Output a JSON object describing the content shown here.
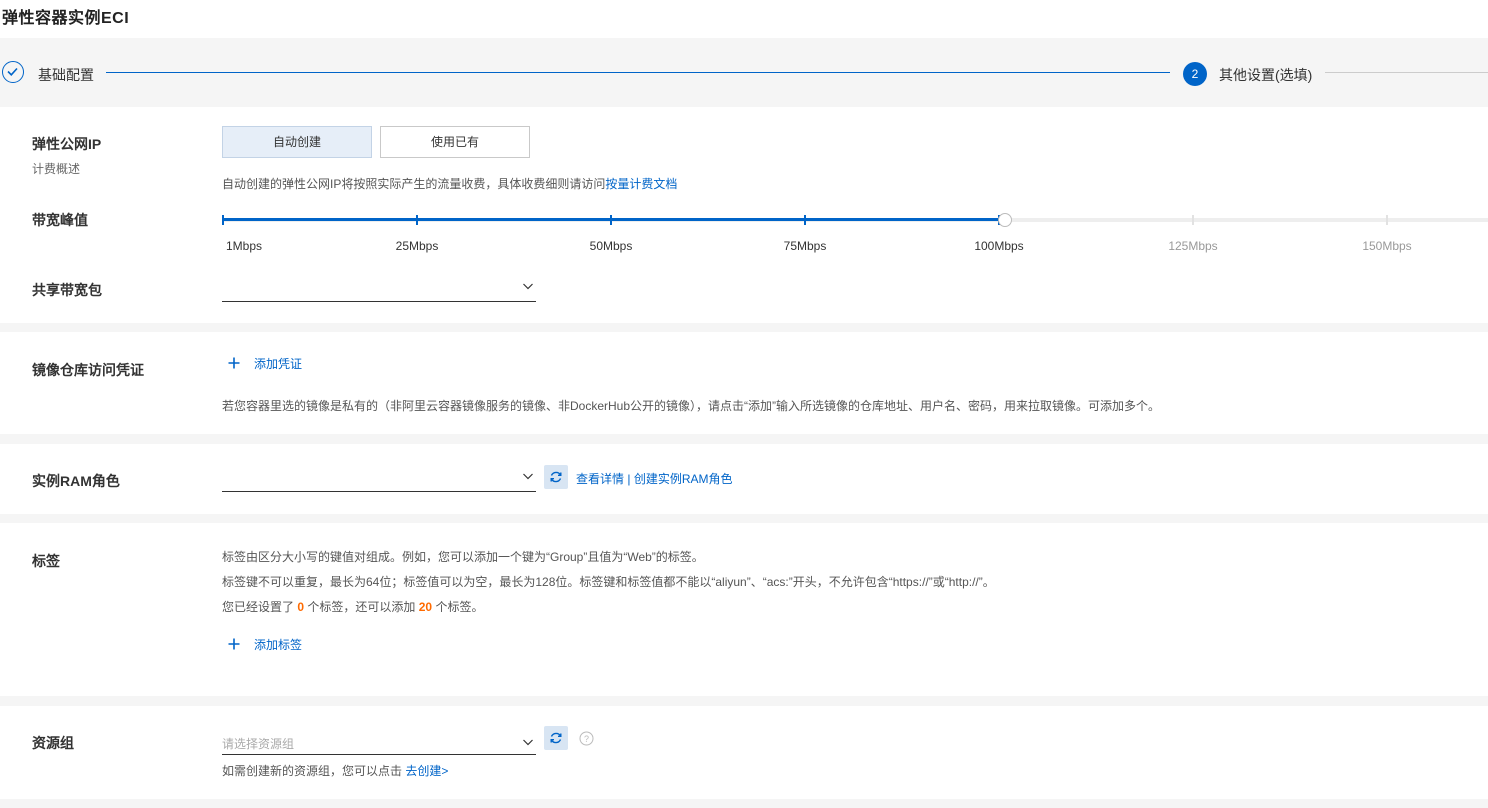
{
  "page": {
    "title": "弹性容器实例ECI"
  },
  "steps": [
    {
      "label": "基础配置",
      "status": "done"
    },
    {
      "number": "2",
      "label": "其他设置(选填)",
      "status": "current"
    }
  ],
  "eip": {
    "label": "弹性公网IP",
    "sublabel": "计费概述",
    "options": [
      "自动创建",
      "使用已有"
    ],
    "selected": "自动创建",
    "note_prefix": "自动创建的弹性公网IP将按照实际产生的流量收费，具体收费细则请访问",
    "note_link": "按量计费文档"
  },
  "bandwidth": {
    "label": "带宽峰值",
    "ticks": [
      "1Mbps",
      "25Mbps",
      "50Mbps",
      "75Mbps",
      "100Mbps",
      "125Mbps",
      "150Mbps"
    ],
    "value_mbps": 100
  },
  "shared_bw": {
    "label": "共享带宽包",
    "value": ""
  },
  "registry": {
    "label": "镜像仓库访问凭证",
    "add_label": "添加凭证",
    "note": "若您容器里选的镜像是私有的（非阿里云容器镜像服务的镜像、非DockerHub公开的镜像），请点击“添加”输入所选镜像的仓库地址、用户名、密码，用来拉取镜像。可添加多个。"
  },
  "ram": {
    "label": "实例RAM角色",
    "value": "",
    "link_detail": "查看详情",
    "separator": "|",
    "link_create": "创建实例RAM角色"
  },
  "tags": {
    "label": "标签",
    "line1": "标签由区分大小写的键值对组成。例如，您可以添加一个键为“Group”且值为“Web”的标签。",
    "line2": "标签键不可以重复，最长为64位；标签值可以为空，最长为128位。标签键和标签值都不能以“aliyun”、“acs:”开头，不允许包含“https://”或“http://”。",
    "line3_prefix": "您已经设置了",
    "count_set": "0",
    "line3_mid": "个标签，还可以添加",
    "count_left": "20",
    "line3_suffix": "个标签。",
    "add_label": "添加标签"
  },
  "resource_group": {
    "label": "资源组",
    "placeholder": "请选择资源组",
    "note_prefix": "如需创建新的资源组，您可以点击",
    "note_link": "去创建>"
  },
  "colors": {
    "accent": "#0064c8",
    "orange": "#ff6a00"
  }
}
